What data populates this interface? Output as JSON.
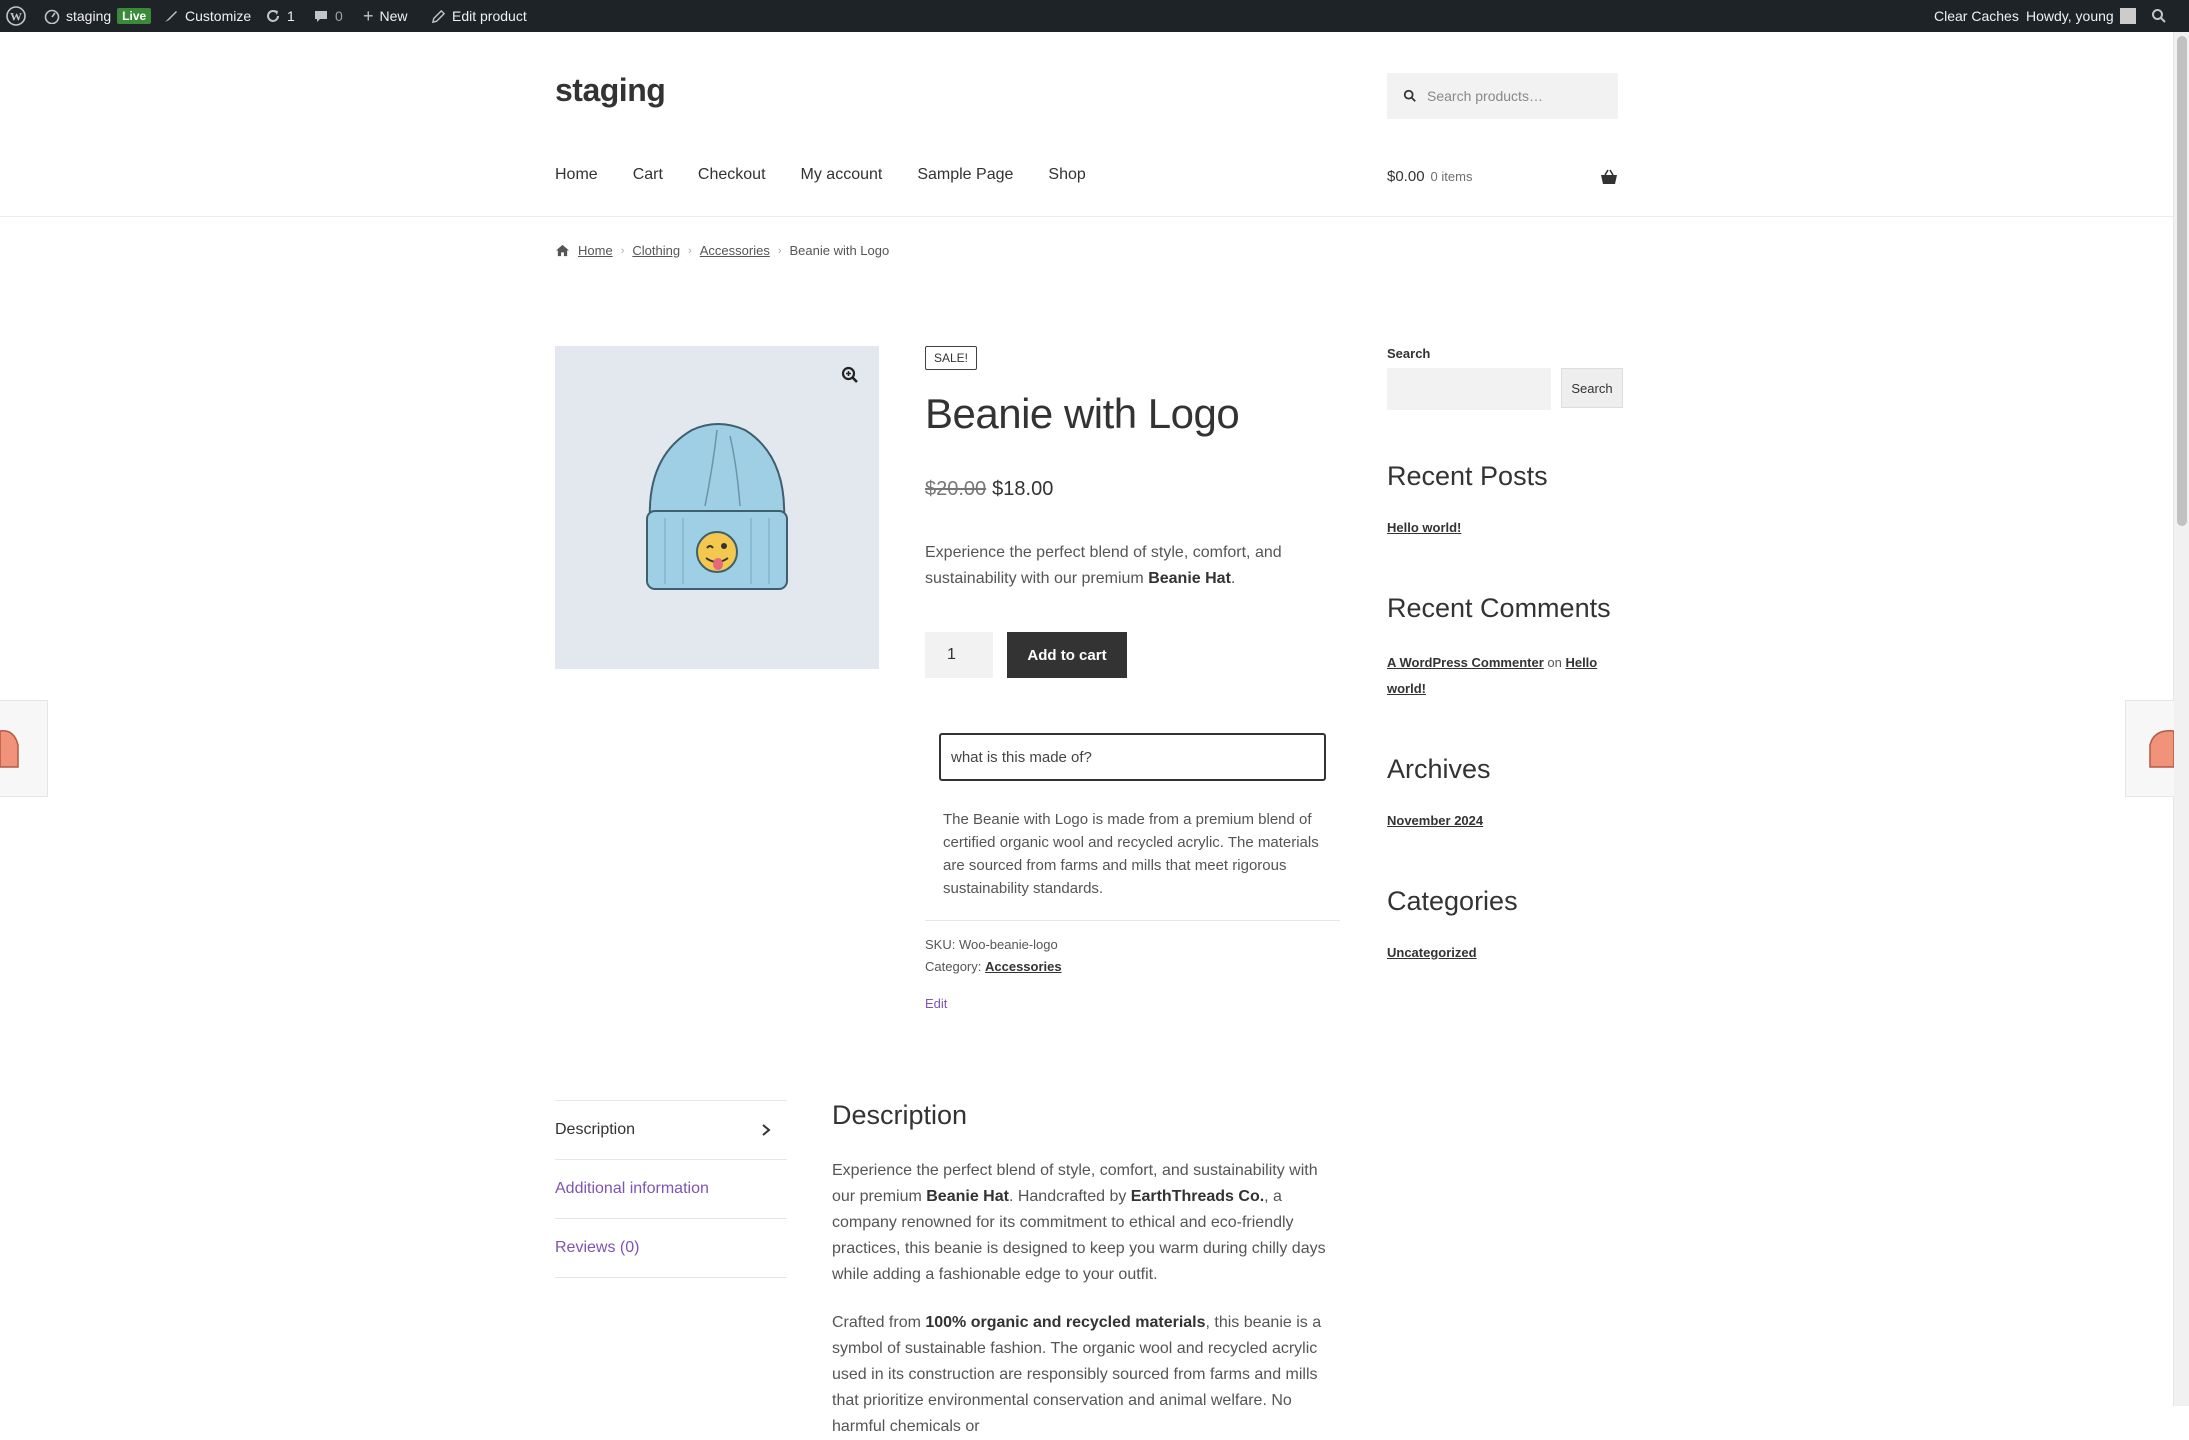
{
  "admin_bar": {
    "site_name": "staging",
    "live_badge": "Live",
    "customize": "Customize",
    "updates_count": "1",
    "comments_count": "0",
    "new_label": "New",
    "edit_product": "Edit product",
    "clear_caches": "Clear Caches",
    "greeting": "Howdy, young"
  },
  "header": {
    "site_title": "staging",
    "search_placeholder": "Search products…",
    "nav": [
      "Home",
      "Cart",
      "Checkout",
      "My account",
      "Sample Page",
      "Shop"
    ],
    "cart_total": "$0.00",
    "cart_items": "0 items"
  },
  "breadcrumb": [
    "Home",
    "Clothing",
    "Accessories",
    "Beanie with Logo"
  ],
  "product": {
    "sale_badge": "SALE!",
    "title": "Beanie with Logo",
    "old_price": "$20.00",
    "price": "$18.00",
    "short_desc_pre": "Experience the perfect blend of style, comfort, and sustainability with our premium ",
    "short_desc_bold": "Beanie Hat",
    "short_desc_post": ".",
    "quantity": "1",
    "add_to_cart": "Add to cart",
    "question_value": "what is this made of?",
    "answer": "The Beanie with Logo is made from a premium blend of certified organic wool and recycled acrylic. The materials are sourced from farms and mills that meet rigorous sustainability standards.",
    "sku_label": "SKU: ",
    "sku": "Woo-beanie-logo",
    "category_label": "Category: ",
    "category": "Accessories",
    "edit": "Edit"
  },
  "sidebar": {
    "search_label": "Search",
    "search_button": "Search",
    "recent_posts_title": "Recent Posts",
    "recent_post": "Hello world!",
    "recent_comments_title": "Recent Comments",
    "comment_author": "A WordPress Commenter",
    "comment_on": " on ",
    "comment_post": "Hello world!",
    "archives_title": "Archives",
    "archive": "November 2024",
    "categories_title": "Categories",
    "category": "Uncategorized"
  },
  "tabs": {
    "items": [
      "Description",
      "Additional information",
      "Reviews (0)"
    ],
    "desc_title": "Description",
    "p1_a": "Experience the perfect blend of style, comfort, and sustainability with our premium ",
    "p1_b": "Beanie Hat",
    "p1_c": ". Handcrafted by ",
    "p1_d": "EarthThreads Co.",
    "p1_e": ", a company renowned for its commitment to ethical and eco-friendly practices, this beanie is designed to keep you warm during chilly days while adding a fashionable edge to your outfit.",
    "p2_a": "Crafted from ",
    "p2_b": "100% organic and recycled materials",
    "p2_c": ", this beanie is a symbol of sustainable fashion. The organic wool and recycled acrylic used in its construction are responsibly sourced from farms and mills that prioritize environmental conservation and animal welfare. No harmful chemicals or"
  },
  "colors": {
    "admin_bar_bg": "#1d2327",
    "accent_link": "#7f54b3",
    "button_dark": "#333333",
    "beanie_blue": "#9fcfe4"
  }
}
